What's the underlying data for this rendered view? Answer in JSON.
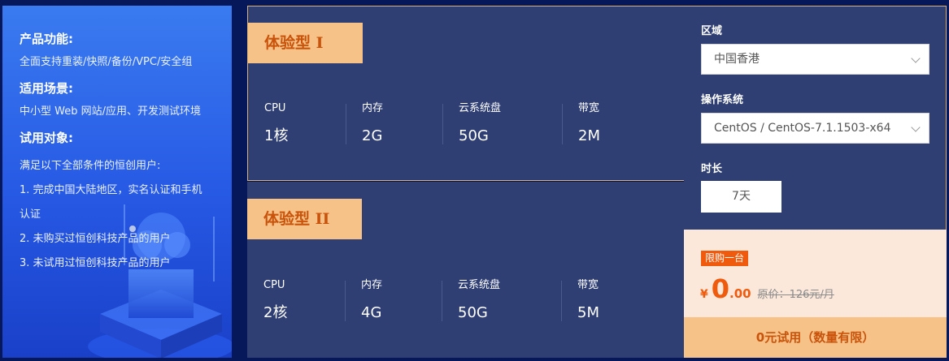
{
  "info": {
    "features_heading": "产品功能:",
    "features_text": "全面支持重装/快照/备份/VPC/安全组",
    "scenarios_heading": "适用场景:",
    "scenarios_text": "中小型 Web 网站/应用、开发测试环境",
    "target_heading": "试用对象:",
    "target_intro": "满足以下全部条件的恒创用户:",
    "conditions": [
      "1. 完成中国大陆地区，实名认证和手机",
      "认证",
      "2. 未购买过恒创科技产品的用户",
      "3. 未试用过恒创科技产品的用户"
    ]
  },
  "plans": [
    {
      "name": "体验型 I",
      "specs": [
        {
          "label": "CPU",
          "value": "1核"
        },
        {
          "label": "内存",
          "value": "2G"
        },
        {
          "label": "云系统盘",
          "value": "50G"
        },
        {
          "label": "带宽",
          "value": "2M"
        }
      ]
    },
    {
      "name": "体验型 II",
      "specs": [
        {
          "label": "CPU",
          "value": "2核"
        },
        {
          "label": "内存",
          "value": "4G"
        },
        {
          "label": "云系统盘",
          "value": "50G"
        },
        {
          "label": "带宽",
          "value": "5M"
        }
      ]
    }
  ],
  "config": {
    "region_label": "区域",
    "region_value": "中国香港",
    "os_label": "操作系统",
    "os_value": "CentOS / CentOS-7.1.1503-x64",
    "duration_label": "时长",
    "duration_value": "7天"
  },
  "price": {
    "badge": "限购一台",
    "currency": "¥",
    "integer": "0",
    "decimal": ".00",
    "original": "原价：126元/月"
  },
  "trial_button": "0元试用（数量有限）",
  "colors": {
    "accent": "#ef5a0c",
    "gold": "#f6c287",
    "card_bg": "#2f3f73",
    "panel_blue": "#2658e4"
  }
}
